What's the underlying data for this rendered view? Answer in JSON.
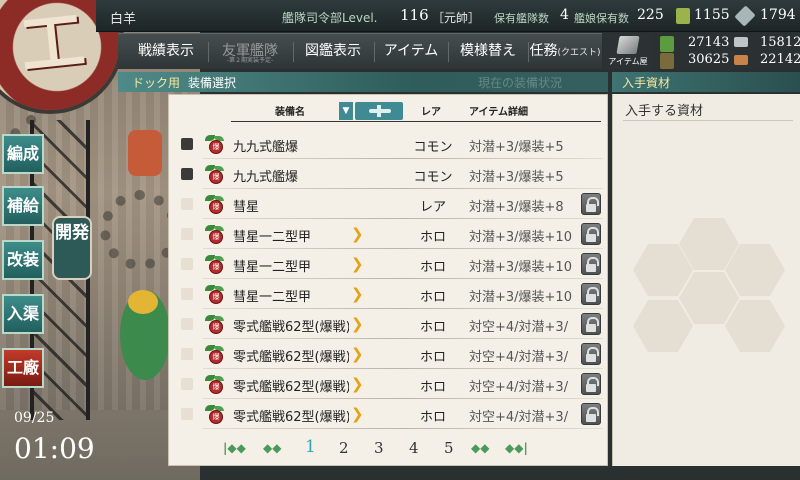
{
  "topbar": {
    "ship_name": "白羊",
    "hq_label": "艦隊司令部Level.",
    "hq_level": "116",
    "hq_rank": "［元帥］",
    "ship_count_label": "保有艦隊数",
    "ship_count": "4",
    "girls_label": "艦娘保有数",
    "girls_count": "225",
    "bucket": "1155",
    "dev_material": "1794"
  },
  "menu": {
    "items": [
      {
        "label": "戦績表示",
        "enabled": true
      },
      {
        "label": "友軍艦隊",
        "sub": "-第２期実装予定-",
        "enabled": false
      },
      {
        "label": "図鑑表示",
        "enabled": true
      },
      {
        "label": "アイテム",
        "enabled": true
      },
      {
        "label": "模様替え",
        "enabled": true
      },
      {
        "label": "任務",
        "sub_inline": "(クエスト)",
        "enabled": true
      }
    ],
    "item_shop_label": "アイテム屋"
  },
  "resources": {
    "fuel": "27143",
    "steel": "15812",
    "ammo": "30625",
    "bauxite": "22142"
  },
  "subheader": {
    "crumb": "ドック用",
    "title": "装備選択",
    "faded": "現在の装備状況"
  },
  "right": {
    "header": "入手資材",
    "label": "入手する資材"
  },
  "table": {
    "col_name": "装備名",
    "col_sort": "▼",
    "col_rarity": "レア",
    "col_detail": "アイテム詳細",
    "rows": [
      {
        "checked": true,
        "name": "九九式艦爆",
        "chevron": false,
        "rarity": "コモン",
        "detail": "対潜+3/爆装+5",
        "locked": false
      },
      {
        "checked": true,
        "name": "九九式艦爆",
        "chevron": false,
        "rarity": "コモン",
        "detail": "対潜+3/爆装+5",
        "locked": false
      },
      {
        "checked": false,
        "name": "彗星",
        "chevron": false,
        "rarity": "レア",
        "detail": "対潜+3/爆装+8",
        "locked": true
      },
      {
        "checked": false,
        "name": "彗星一二型甲",
        "chevron": true,
        "rarity": "ホロ",
        "detail": "対潜+3/爆装+10",
        "locked": true
      },
      {
        "checked": false,
        "name": "彗星一二型甲",
        "chevron": true,
        "rarity": "ホロ",
        "detail": "対潜+3/爆装+10",
        "locked": true
      },
      {
        "checked": false,
        "name": "彗星一二型甲",
        "chevron": true,
        "rarity": "ホロ",
        "detail": "対潜+3/爆装+10",
        "locked": true
      },
      {
        "checked": false,
        "name": "零式艦戦62型(爆戦)",
        "chevron": true,
        "rarity": "ホロ",
        "detail": "対空+4/対潜+3/",
        "locked": true
      },
      {
        "checked": false,
        "name": "零式艦戦62型(爆戦)",
        "chevron": true,
        "rarity": "ホロ",
        "detail": "対空+4/対潜+3/",
        "locked": true
      },
      {
        "checked": false,
        "name": "零式艦戦62型(爆戦)",
        "chevron": true,
        "rarity": "ホロ",
        "detail": "対空+4/対潜+3/",
        "locked": true
      },
      {
        "checked": false,
        "name": "零式艦戦62型(爆戦)",
        "chevron": true,
        "rarity": "ホロ",
        "detail": "対空+4/対潜+3/",
        "locked": true
      }
    ],
    "equip_badge": "爆"
  },
  "pager": {
    "pages": [
      "1",
      "2",
      "3",
      "4",
      "5"
    ],
    "current": "1",
    "first": "|◆◆",
    "prev": "◆◆",
    "next": "◆◆",
    "last": "◆◆|"
  },
  "nav": {
    "items": [
      "編成",
      "補給",
      "改装",
      "入渠",
      "工廠"
    ],
    "current": "開発"
  },
  "clock": {
    "date": "09/25",
    "time": "01:09"
  },
  "colors": {
    "accent": "#2fa5b3",
    "chevron": "#e3a316",
    "sub_crumb": "#f4e7a3"
  }
}
